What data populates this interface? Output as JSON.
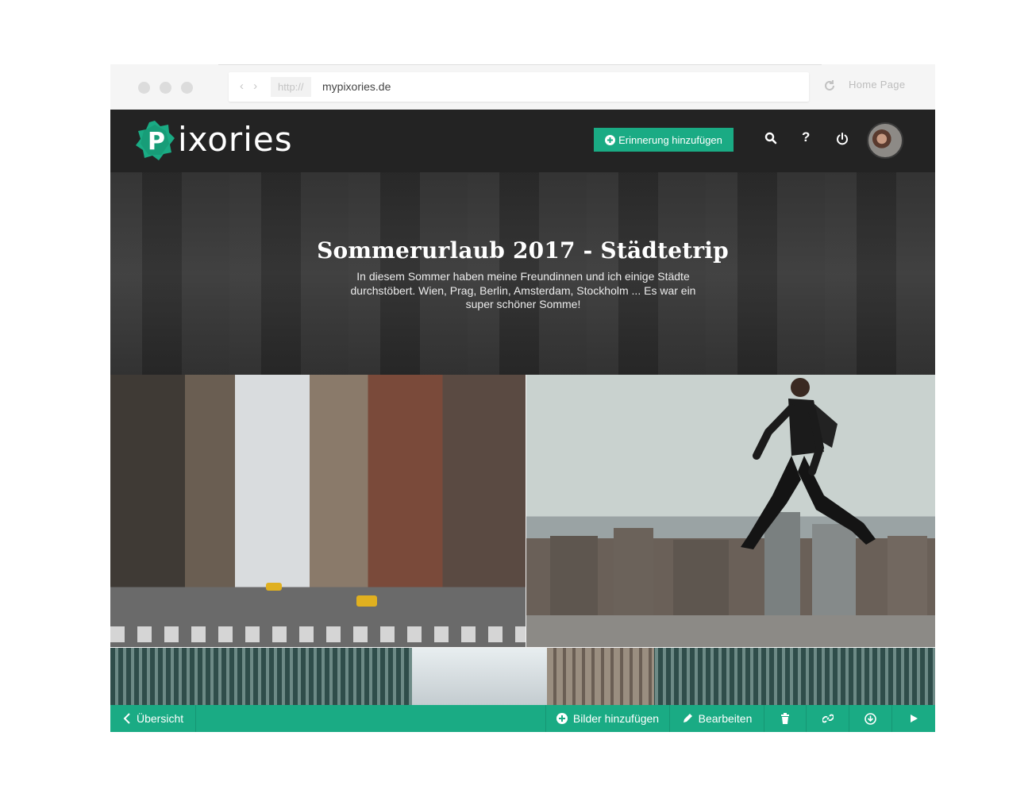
{
  "browser": {
    "protocol": "http://",
    "url": "mypixories.de",
    "home_label": "Home Page",
    "nav_arrows": "‹ ›"
  },
  "header": {
    "logo_text": "ixories",
    "logo_letter": "P",
    "add_memory_label": "Erinnerung hinzufügen",
    "search_icon": "search-icon",
    "help_glyph": "?",
    "power_icon": "power-icon",
    "accent_color": "#1aab84",
    "bar_color": "#232323"
  },
  "album": {
    "title": "Sommerurlaub 2017 - Städtetrip",
    "description": "In diesem Sommer haben meine Freundinnen und ich einige Städte durchstöbert. Wien, Prag, Berlin, Amsterdam, Stockholm ... Es war ein super schöner Somme!"
  },
  "toolbar": {
    "back_label": "Übersicht",
    "add_images_label": "Bilder hinzufügen",
    "edit_label": "Bearbeiten",
    "delete_icon": "trash-icon",
    "link_icon": "link-icon",
    "download_icon": "download-icon",
    "play_icon": "play-icon"
  }
}
